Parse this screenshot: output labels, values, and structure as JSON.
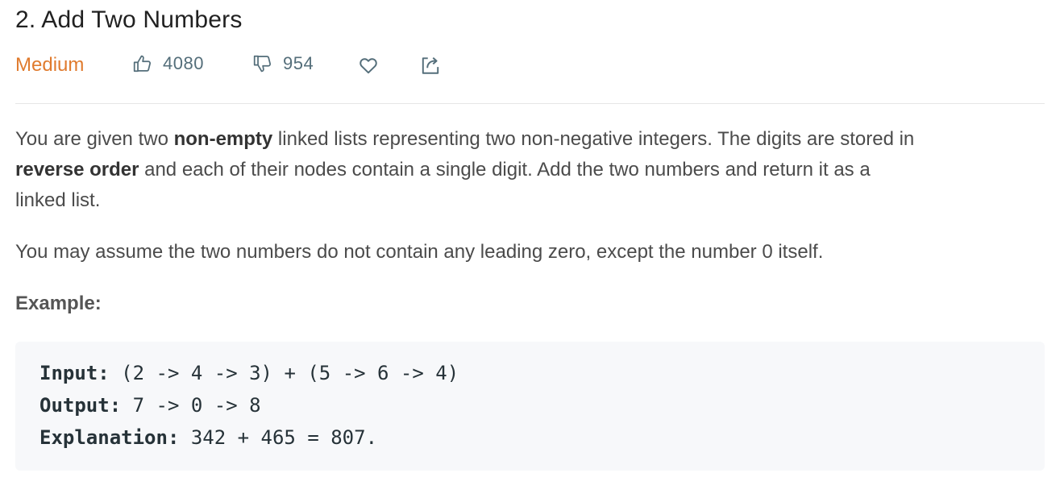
{
  "problem": {
    "title": "2. Add Two Numbers",
    "difficulty": "Medium",
    "likes": "4080",
    "dislikes": "954",
    "difficulty_color": "#e07b2e"
  },
  "icons": {
    "like": "thumbs-up-icon",
    "dislike": "thumbs-down-icon",
    "favorite": "heart-icon",
    "share": "share-icon"
  },
  "description": {
    "p1": {
      "t1": "You are given two ",
      "b1": "non-empty",
      "t2": " linked lists representing two non-negative integers. The digits are stored in",
      "b2": "reverse order",
      "t3": " and each of their nodes contain a single digit. Add the two numbers and return it as a",
      "t4": "linked list."
    },
    "p2": "You may assume the two numbers do not contain any leading zero, except the number 0 itself.",
    "example_label": "Example:"
  },
  "example": {
    "input_label": "Input:",
    "input_value": " (2 -> 4 -> 3) + (5 -> 6 -> 4)",
    "output_label": "Output:",
    "output_value": " 7 -> 0 -> 8",
    "explanation_label": "Explanation:",
    "explanation_value": " 342 + 465 = 807."
  }
}
